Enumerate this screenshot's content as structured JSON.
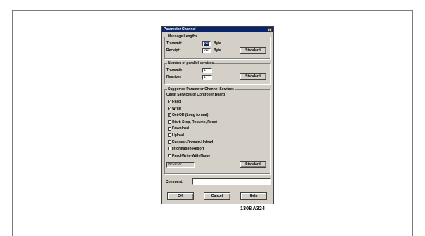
{
  "dialog": {
    "title": "Parameter Channel",
    "close_glyph": "x"
  },
  "message_lengths": {
    "title": "Message Lengths",
    "transmit_label": "Transmit:",
    "transmit_value": "240",
    "transmit_unit": "Byte",
    "receipt_label": "Receipt:",
    "receipt_value": "240",
    "receipt_unit": "Byte",
    "standard_label": "Standard"
  },
  "parallel_services": {
    "title": "Number of parallel services",
    "transmit_label": "Transmit:",
    "transmit_value": "1",
    "receive_label": "Receive:",
    "receive_value": "1",
    "standard_label": "Standard"
  },
  "supported_services": {
    "title": "Supported Parameter Channel Services",
    "subtitle": "Client Services of Controller Board",
    "items": [
      {
        "label": "Read",
        "checked": true
      },
      {
        "label": "Write",
        "checked": true
      },
      {
        "label": "Get-OD (Long format)",
        "checked": true
      },
      {
        "label": "Start, Stop, Resume, Reset",
        "checked": false
      },
      {
        "label": "Download",
        "checked": false
      },
      {
        "label": "Upload",
        "checked": false
      },
      {
        "label": "Request-Domain-Upload",
        "checked": false
      },
      {
        "label": "Information-Report",
        "checked": false
      },
      {
        "label": "Read-Write-With-Name",
        "checked": false
      }
    ],
    "time_value": "00:30:00",
    "standard_label": "Standard"
  },
  "comment": {
    "label": "Comment:",
    "value": ""
  },
  "footer": {
    "ok_label": "OK",
    "cancel_label": "Cancel",
    "help_label": "Help"
  },
  "figure_code": "130BA324"
}
